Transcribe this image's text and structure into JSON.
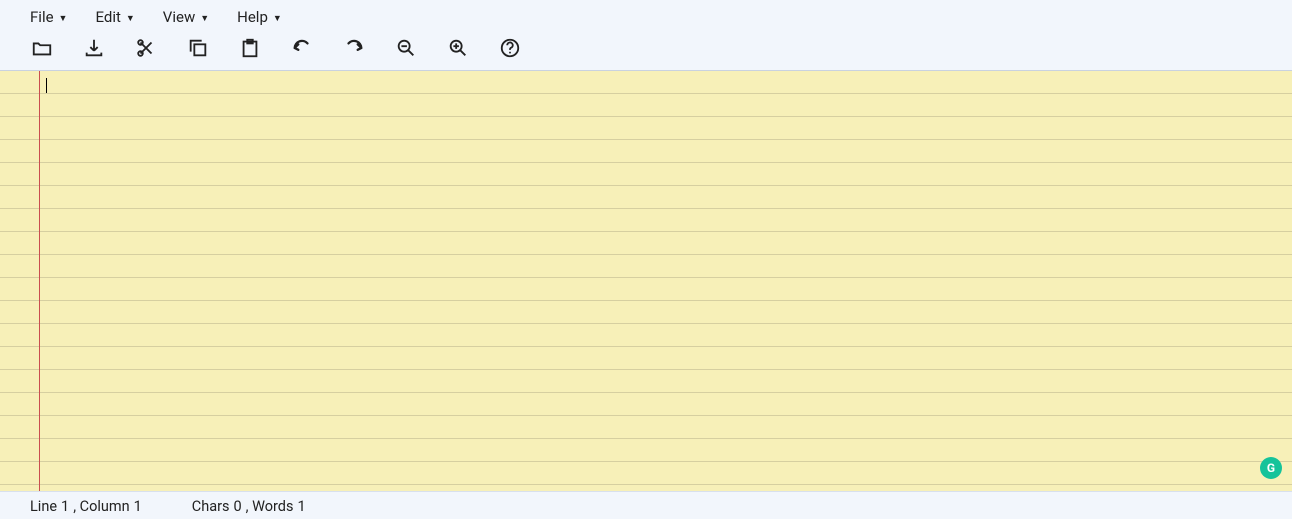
{
  "menubar": {
    "items": [
      {
        "label": "File"
      },
      {
        "label": "Edit"
      },
      {
        "label": "View"
      },
      {
        "label": "Help"
      }
    ]
  },
  "toolbar": {
    "icons": [
      "folder-open-icon",
      "download-icon",
      "cut-icon",
      "copy-icon",
      "paste-icon",
      "undo-icon",
      "redo-icon",
      "zoom-out-icon",
      "zoom-in-icon",
      "help-icon"
    ]
  },
  "editor": {
    "content": ""
  },
  "statusbar": {
    "position_prefix": "Line ",
    "line": "1",
    "position_mid": ", Column ",
    "column": "1",
    "chars_prefix": "Chars ",
    "chars": "0",
    "words_prefix": ", Words ",
    "words": "1"
  },
  "badge": {
    "letter": "G"
  }
}
